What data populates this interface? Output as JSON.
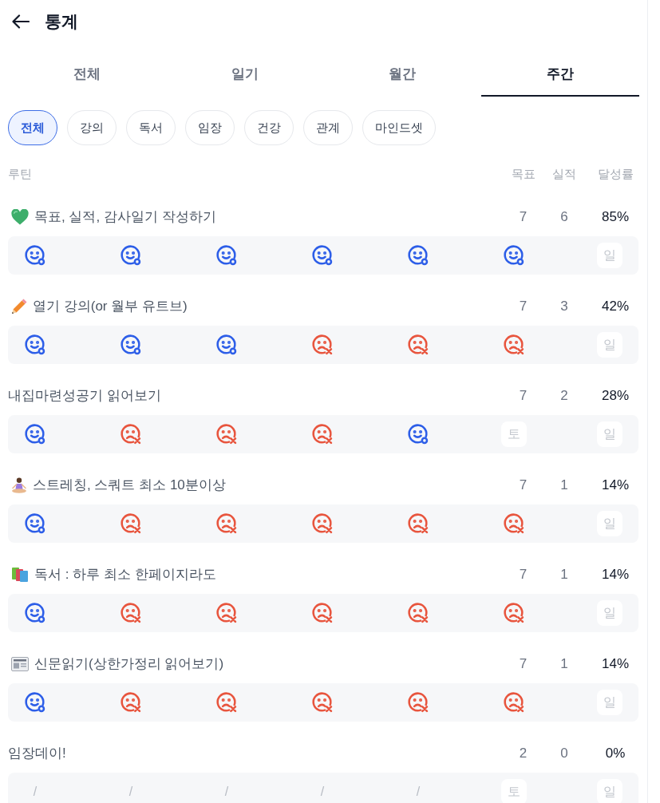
{
  "header": {
    "title": "통계"
  },
  "tabs": [
    {
      "label": "전체",
      "selected": false
    },
    {
      "label": "일기",
      "selected": false
    },
    {
      "label": "월간",
      "selected": false
    },
    {
      "label": "주간",
      "selected": true
    }
  ],
  "filters": [
    {
      "label": "전체",
      "selected": true
    },
    {
      "label": "강의",
      "selected": false
    },
    {
      "label": "독서",
      "selected": false
    },
    {
      "label": "임장",
      "selected": false
    },
    {
      "label": "건강",
      "selected": false
    },
    {
      "label": "관계",
      "selected": false
    },
    {
      "label": "마인드셋",
      "selected": false
    }
  ],
  "table": {
    "columns": [
      "루틴",
      "목표",
      "실적",
      "달성률"
    ]
  },
  "routines": [
    {
      "name": "목표, 실적, 감사일기 작성하기",
      "goal": "7",
      "actual": "6",
      "rate": "85%",
      "days": [
        {
          "kind": "done"
        },
        {
          "kind": "done"
        },
        {
          "kind": "done"
        },
        {
          "kind": "done"
        },
        {
          "kind": "done"
        },
        {
          "kind": "done"
        },
        {
          "kind": "rest",
          "label": "일"
        }
      ]
    },
    {
      "name": "열기 강의(or 월부 유트브)",
      "goal": "7",
      "actual": "3",
      "rate": "42%",
      "days": [
        {
          "kind": "done"
        },
        {
          "kind": "done"
        },
        {
          "kind": "done"
        },
        {
          "kind": "missed"
        },
        {
          "kind": "missed"
        },
        {
          "kind": "missed"
        },
        {
          "kind": "rest",
          "label": "일"
        }
      ]
    },
    {
      "name": "내집마련성공기 읽어보기",
      "goal": "7",
      "actual": "2",
      "rate": "28%",
      "days": [
        {
          "kind": "done"
        },
        {
          "kind": "missed"
        },
        {
          "kind": "missed"
        },
        {
          "kind": "missed"
        },
        {
          "kind": "done"
        },
        {
          "kind": "rest",
          "label": "토"
        },
        {
          "kind": "rest",
          "label": "일"
        }
      ]
    },
    {
      "name": "스트레칭, 스쿼트 최소 10분이상",
      "goal": "7",
      "actual": "1",
      "rate": "14%",
      "days": [
        {
          "kind": "done"
        },
        {
          "kind": "missed"
        },
        {
          "kind": "missed"
        },
        {
          "kind": "missed"
        },
        {
          "kind": "missed"
        },
        {
          "kind": "missed"
        },
        {
          "kind": "rest",
          "label": "일"
        }
      ]
    },
    {
      "name": "독서 : 하루 최소 한페이지라도",
      "goal": "7",
      "actual": "1",
      "rate": "14%",
      "days": [
        {
          "kind": "done"
        },
        {
          "kind": "missed"
        },
        {
          "kind": "missed"
        },
        {
          "kind": "missed"
        },
        {
          "kind": "missed"
        },
        {
          "kind": "missed"
        },
        {
          "kind": "rest",
          "label": "일"
        }
      ]
    },
    {
      "name": "신문읽기(상한가정리 읽어보기)",
      "goal": "7",
      "actual": "1",
      "rate": "14%",
      "days": [
        {
          "kind": "done"
        },
        {
          "kind": "missed"
        },
        {
          "kind": "missed"
        },
        {
          "kind": "missed"
        },
        {
          "kind": "missed"
        },
        {
          "kind": "missed"
        },
        {
          "kind": "rest",
          "label": "일"
        }
      ]
    },
    {
      "name": "임장데이!",
      "goal": "2",
      "actual": "0",
      "rate": "0%",
      "days": [
        {
          "kind": "empty",
          "label": "/"
        },
        {
          "kind": "empty",
          "label": "/"
        },
        {
          "kind": "empty",
          "label": "/"
        },
        {
          "kind": "empty",
          "label": "/"
        },
        {
          "kind": "empty",
          "label": "/"
        },
        {
          "kind": "rest",
          "label": "토"
        },
        {
          "kind": "rest",
          "label": "일"
        }
      ]
    }
  ]
}
